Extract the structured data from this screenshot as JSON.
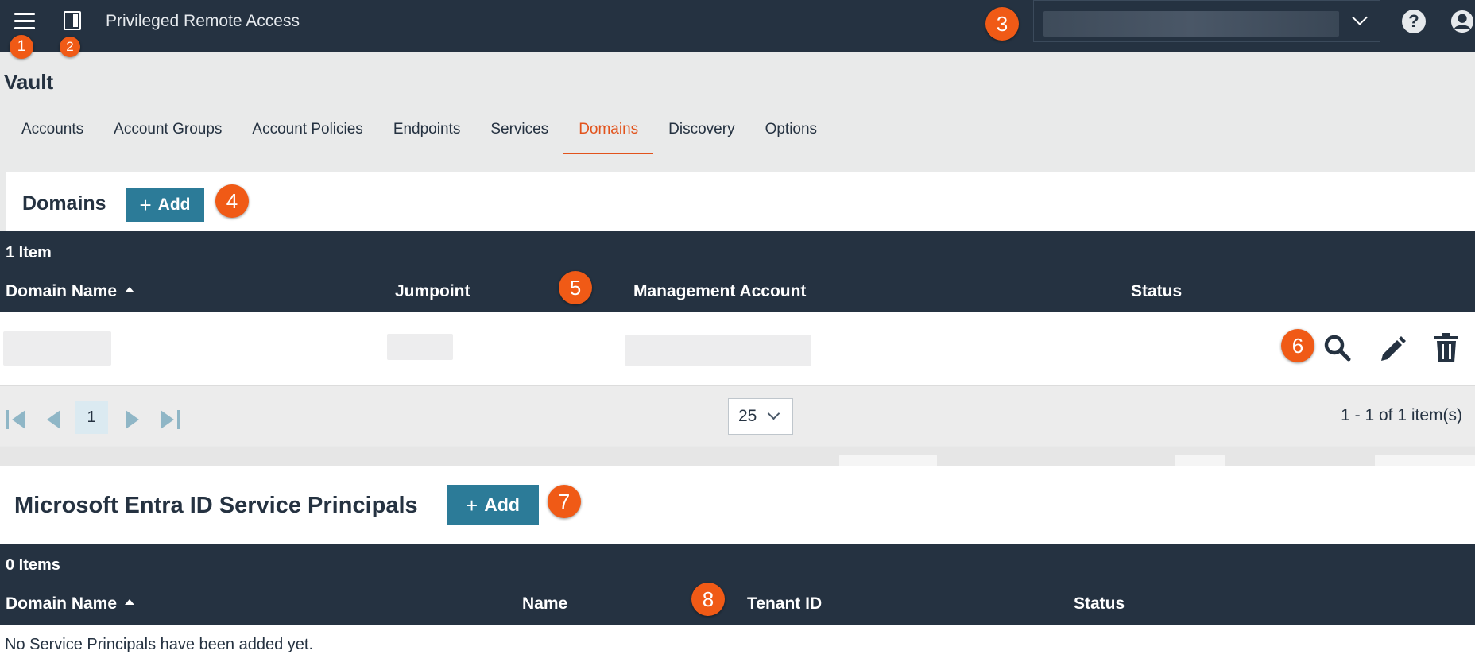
{
  "topbar": {
    "app_title": "Privileged Remote Access",
    "menu_icon": "hamburger-menu-icon",
    "panel_icon": "side-panel-icon",
    "help_icon": "help-icon",
    "user_icon": "user-account-icon",
    "help_glyph": "?"
  },
  "callouts": [
    "1",
    "2",
    "3",
    "4",
    "5",
    "6",
    "7",
    "8"
  ],
  "vault": {
    "title": "Vault",
    "tabs": [
      {
        "label": "Accounts",
        "active": false
      },
      {
        "label": "Account Groups",
        "active": false
      },
      {
        "label": "Account Policies",
        "active": false
      },
      {
        "label": "Endpoints",
        "active": false
      },
      {
        "label": "Services",
        "active": false
      },
      {
        "label": "Domains",
        "active": true
      },
      {
        "label": "Discovery",
        "active": false
      },
      {
        "label": "Options",
        "active": false
      }
    ]
  },
  "domains": {
    "title": "Domains",
    "add_label": "Add",
    "add_glyph": "+",
    "count": "1 Item",
    "columns": [
      "Domain Name",
      "Jumpoint",
      "Management Account",
      "Status"
    ],
    "actions": [
      "view-icon",
      "edit-icon",
      "delete-icon"
    ],
    "pager": {
      "page": "1",
      "per_page": "25",
      "range": "1 - 1 of 1 item(s)"
    }
  },
  "service_principals": {
    "title": "Microsoft Entra ID Service Principals",
    "add_label": "Add",
    "add_glyph": "+",
    "count": "0 Items",
    "columns": [
      "Domain Name",
      "Name",
      "Tenant ID",
      "Status"
    ],
    "empty_message": "No Service Principals have been added yet."
  },
  "colors": {
    "topbar": "#253241",
    "accent": "#e2531c",
    "button": "#2c7b98",
    "callout": "#f05a16"
  }
}
